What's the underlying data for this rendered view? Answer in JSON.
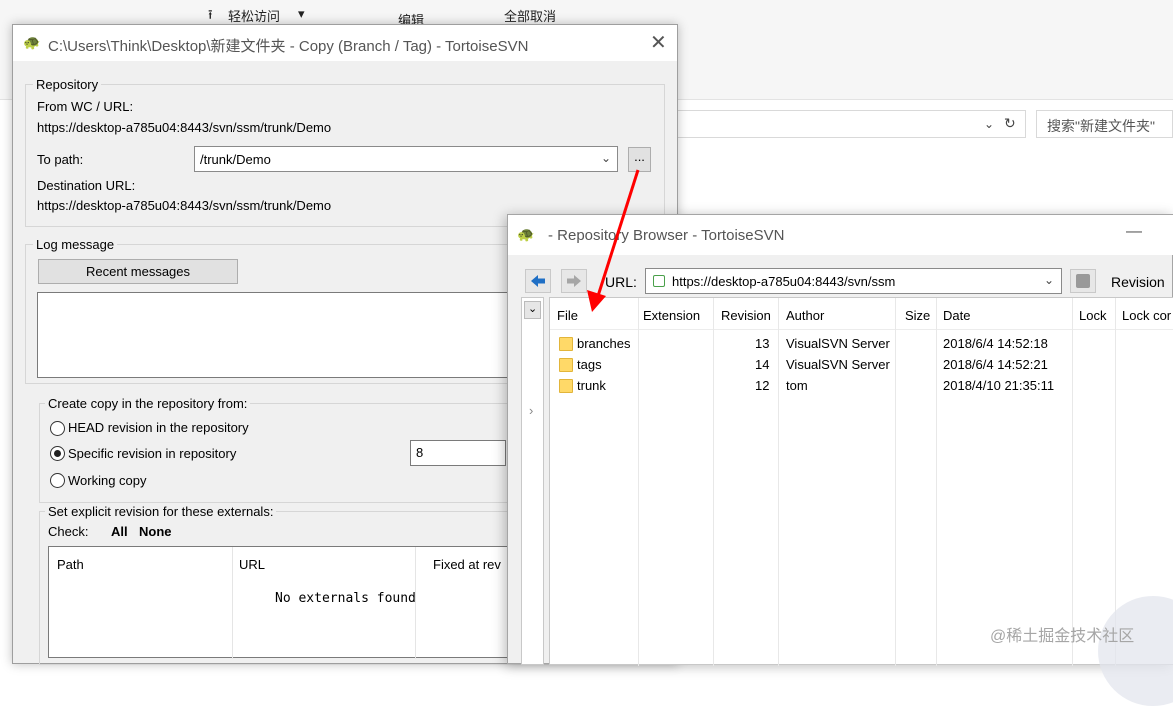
{
  "explorer": {
    "ribbon_easy_access": "轻松访问",
    "ribbon_edit": "编辑",
    "ribbon_select_none": "全部取消",
    "search_placeholder": "搜索\"新建文件夹\"",
    "refresh_icon": "refresh-icon"
  },
  "copy_dialog": {
    "title": "C:\\Users\\Think\\Desktop\\新建文件夹 - Copy (Branch / Tag) - TortoiseSVN",
    "repository_group": "Repository",
    "from_label": "From WC / URL:",
    "from_value": "https://desktop-a785u04:8443/svn/ssm/trunk/Demo",
    "to_path_label": "To path:",
    "to_path_value": "/trunk/Demo",
    "browse_button": "...",
    "dest_url_label": "Destination URL:",
    "dest_url_value": "https://desktop-a785u04:8443/svn/ssm/trunk/Demo",
    "log_group": "Log message",
    "recent_messages_button": "Recent messages",
    "create_copy_group": "Create copy in the repository from:",
    "radio_head": "HEAD revision in the repository",
    "radio_specific": "Specific revision in repository",
    "radio_working": "Working copy",
    "revision_value": "8",
    "externals_label": "Set explicit revision for these externals:",
    "check_label": "Check:",
    "check_all": "All",
    "check_none": "None",
    "externals_columns": [
      "Path",
      "URL",
      "Fixed at rev"
    ],
    "externals_empty": "No externals found"
  },
  "repo_browser": {
    "title": "- Repository Browser - TortoiseSVN",
    "minimize": "—",
    "url_label": "URL:",
    "url_value": "https://desktop-a785u04:8443/svn/ssm",
    "revision_label": "Revision",
    "columns": [
      "File",
      "Extension",
      "Revision",
      "Author",
      "Size",
      "Date",
      "Lock",
      "Lock cor"
    ],
    "rows": [
      {
        "file": "branches",
        "extension": "",
        "revision": "13",
        "author": "VisualSVN Server",
        "size": "",
        "date": "2018/6/4 14:52:18"
      },
      {
        "file": "tags",
        "extension": "",
        "revision": "14",
        "author": "VisualSVN Server",
        "size": "",
        "date": "2018/6/4 14:52:21"
      },
      {
        "file": "trunk",
        "extension": "",
        "revision": "12",
        "author": "tom",
        "size": "",
        "date": "2018/4/10 21:35:11"
      }
    ]
  },
  "annotation": {
    "arrow_color": "#ff0000"
  },
  "watermark": "@稀土掘金技术社区"
}
